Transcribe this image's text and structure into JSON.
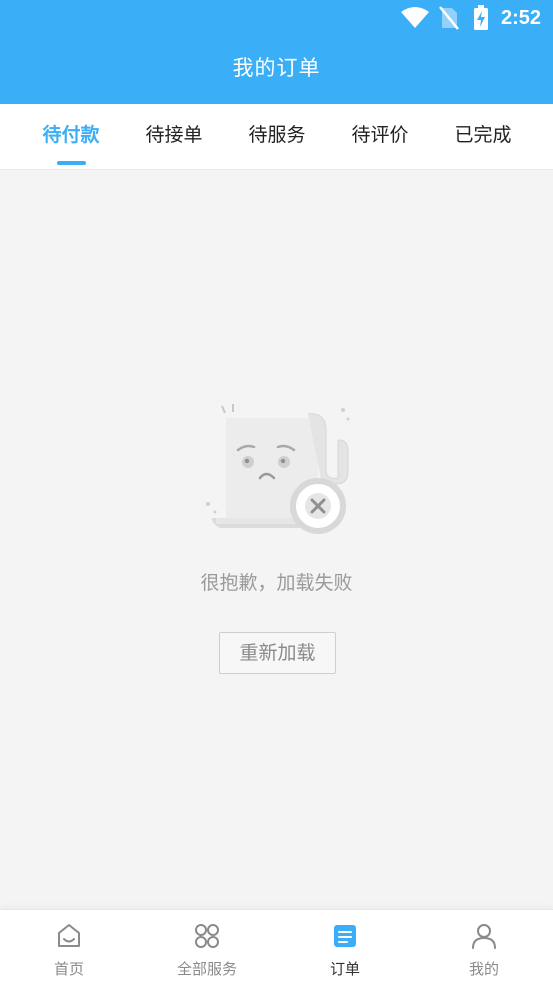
{
  "status_bar": {
    "time": "2:52"
  },
  "header": {
    "title": "我的订单"
  },
  "tabs": [
    {
      "label": "待付款",
      "active": true
    },
    {
      "label": "待接单",
      "active": false
    },
    {
      "label": "待服务",
      "active": false
    },
    {
      "label": "待评价",
      "active": false
    },
    {
      "label": "已完成",
      "active": false
    }
  ],
  "error_state": {
    "message": "很抱歉，加载失败",
    "reload_label": "重新加载"
  },
  "bottom_nav": [
    {
      "label": "首页",
      "icon": "home-icon",
      "active": false
    },
    {
      "label": "全部服务",
      "icon": "services-grid-icon",
      "active": false
    },
    {
      "label": "订单",
      "icon": "orders-icon",
      "active": true
    },
    {
      "label": "我的",
      "icon": "profile-icon",
      "active": false
    }
  ],
  "colors": {
    "accent": "#3aaef6",
    "background": "#f4f4f4",
    "muted_text": "#9a9a9a"
  }
}
